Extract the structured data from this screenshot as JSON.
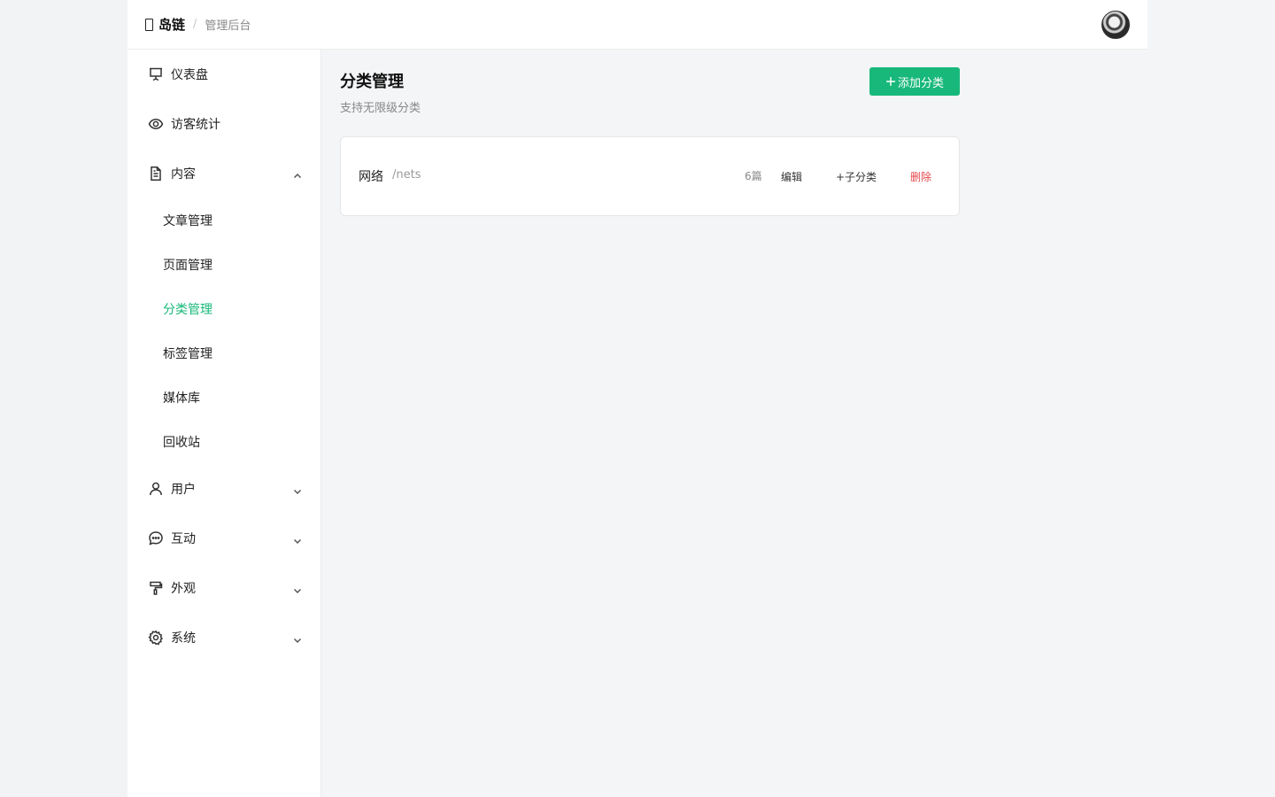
{
  "header": {
    "brand_name": "岛链",
    "separator": "/",
    "subtitle": "管理后台"
  },
  "sidebar": {
    "items": [
      {
        "label": "仪表盘",
        "icon": "presentation-board-icon"
      },
      {
        "label": "访客统计",
        "icon": "eye-icon"
      },
      {
        "label": "内容",
        "icon": "document-icon",
        "expanded": true,
        "children": [
          {
            "label": "文章管理"
          },
          {
            "label": "页面管理"
          },
          {
            "label": "分类管理",
            "active": true
          },
          {
            "label": "标签管理"
          },
          {
            "label": "媒体库"
          },
          {
            "label": "回收站"
          }
        ]
      },
      {
        "label": "用户",
        "icon": "user-icon",
        "expanded": false
      },
      {
        "label": "互动",
        "icon": "chat-bubble-icon",
        "expanded": false
      },
      {
        "label": "外观",
        "icon": "paint-roller-icon",
        "expanded": false
      },
      {
        "label": "系统",
        "icon": "gear-icon",
        "expanded": false
      }
    ]
  },
  "main": {
    "title": "分类管理",
    "subtitle": "支持无限级分类",
    "add_button": "添加分类",
    "add_button_icon": "plus-icon",
    "categories": [
      {
        "name": "网络",
        "slug": "/nets",
        "count": "6篇",
        "edit": "编辑",
        "add_child": "+子分类",
        "delete": "删除"
      }
    ]
  },
  "colors": {
    "accent": "#18b87a",
    "danger": "#e5484d"
  }
}
